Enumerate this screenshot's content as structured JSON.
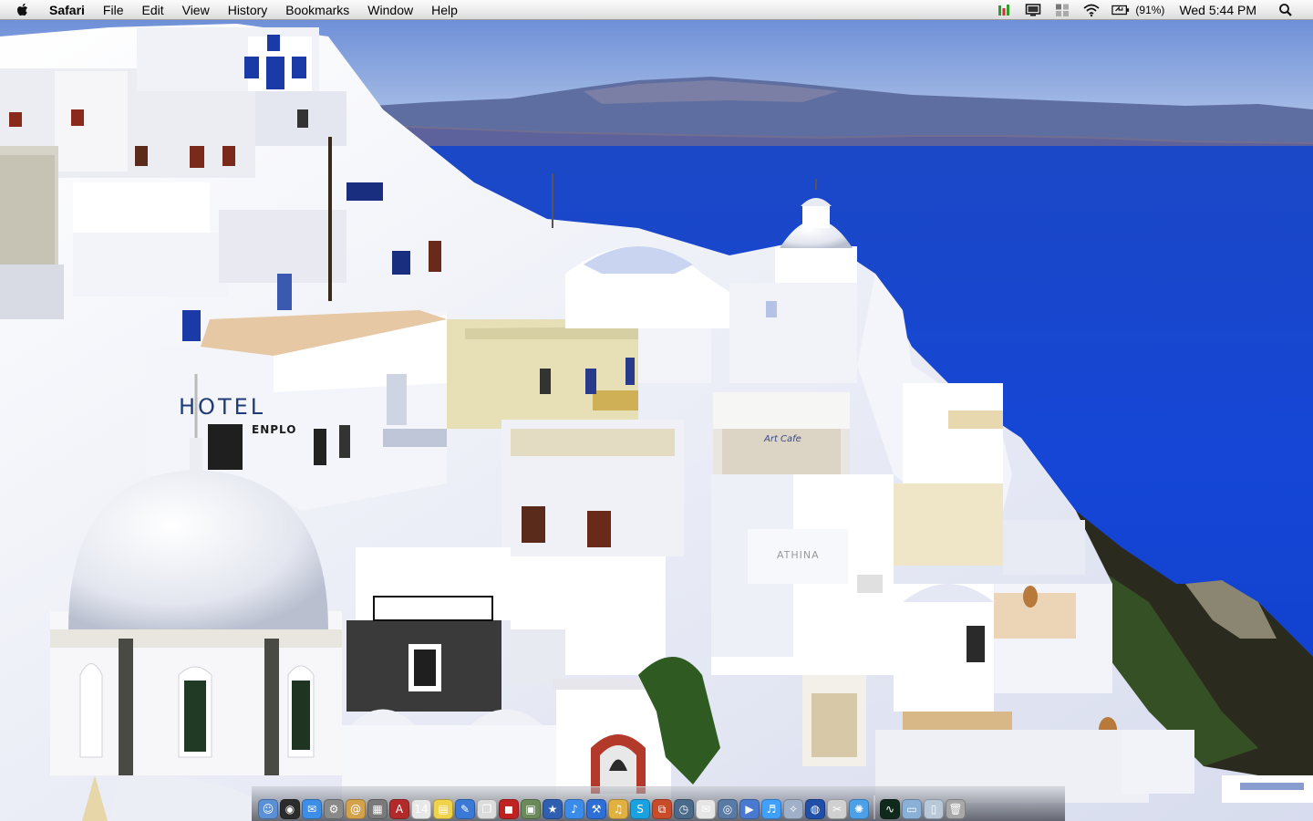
{
  "menubar": {
    "app_name": "Safari",
    "menus": [
      "File",
      "Edit",
      "View",
      "History",
      "Bookmarks",
      "Window",
      "Help"
    ],
    "battery_percent": "(91%)",
    "clock": "Wed 5:44 PM"
  },
  "wallpaper": {
    "sign_hotel": "HOTEL",
    "sign_enplo": "ENPLO",
    "sign_athina": "ATHINA",
    "sign_cafe": "Art Cafe"
  },
  "dock": {
    "icons": [
      {
        "name": "finder-icon",
        "color": "#5b8fd6",
        "glyph": "☺"
      },
      {
        "name": "dashboard-icon",
        "color": "#2c2c2c",
        "glyph": "◉"
      },
      {
        "name": "ichat-icon",
        "color": "#3c8ee6",
        "glyph": "✉"
      },
      {
        "name": "system-preferences-icon",
        "color": "#8a8a8a",
        "glyph": "⚙"
      },
      {
        "name": "address-book-icon",
        "color": "#d4a24a",
        "glyph": "@"
      },
      {
        "name": "calculator-icon",
        "color": "#7a7a7a",
        "glyph": "▦"
      },
      {
        "name": "dictionary-icon",
        "color": "#b32a2a",
        "glyph": "A"
      },
      {
        "name": "ical-icon",
        "color": "#e8e8e8",
        "glyph": "14"
      },
      {
        "name": "stickies-icon",
        "color": "#f0d34a",
        "glyph": "▤"
      },
      {
        "name": "textedit-icon",
        "color": "#3a7ad6",
        "glyph": "✎"
      },
      {
        "name": "preview-icon",
        "color": "#dcdcdc",
        "glyph": "❐"
      },
      {
        "name": "photo-booth-icon",
        "color": "#c02222",
        "glyph": "◼"
      },
      {
        "name": "iphoto-icon",
        "color": "#6a8a5a",
        "glyph": "▣"
      },
      {
        "name": "imovie-icon",
        "color": "#2f5fb0",
        "glyph": "★"
      },
      {
        "name": "itunes-icon",
        "color": "#3b8be8",
        "glyph": "♪"
      },
      {
        "name": "xcode-icon",
        "color": "#2d6fd6",
        "glyph": "⚒"
      },
      {
        "name": "garageband-icon",
        "color": "#e0b040",
        "glyph": "♫"
      },
      {
        "name": "skype-icon",
        "color": "#1aa1e0",
        "glyph": "S"
      },
      {
        "name": "remote-desktop-icon",
        "color": "#c84b2a",
        "glyph": "⧉"
      },
      {
        "name": "time-machine-icon",
        "color": "#4a6a8a",
        "glyph": "◷"
      },
      {
        "name": "image-capture-icon",
        "color": "#e6e6e6",
        "glyph": "✉"
      },
      {
        "name": "network-icon",
        "color": "#5a7aa6",
        "glyph": "◎"
      },
      {
        "name": "quicktime-icon",
        "color": "#4a7ad0",
        "glyph": "▶"
      },
      {
        "name": "itunes-music-icon",
        "color": "#3fa0ff",
        "glyph": "♬"
      },
      {
        "name": "automator-icon",
        "color": "#a0b0c8",
        "glyph": "✧"
      },
      {
        "name": "google-earth-icon",
        "color": "#1f4fa8",
        "glyph": "◍"
      },
      {
        "name": "utility-icon",
        "color": "#d0d0d0",
        "glyph": "✂"
      },
      {
        "name": "safari-icon",
        "color": "#4ba0e8",
        "glyph": "✺"
      },
      {
        "name": "activity-monitor-icon",
        "color": "#0f2a1a",
        "glyph": "∿"
      },
      {
        "name": "downloads-stack-icon",
        "color": "#8ab0d8",
        "glyph": "▭"
      },
      {
        "name": "documents-stack-icon",
        "color": "#b8c8d8",
        "glyph": "▯"
      },
      {
        "name": "trash-icon",
        "color": "#a8a8a8",
        "glyph": "🗑"
      }
    ]
  }
}
